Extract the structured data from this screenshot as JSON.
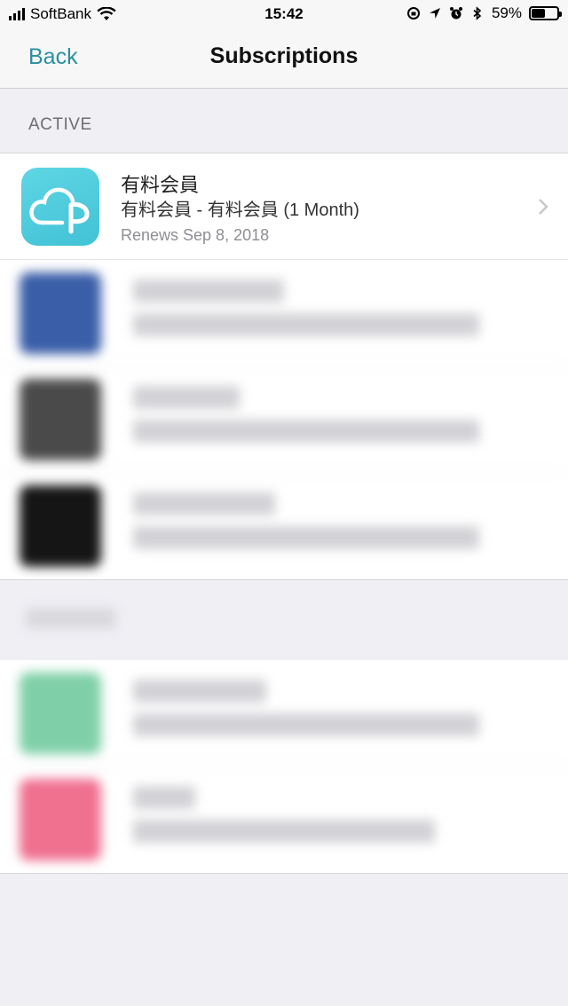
{
  "status": {
    "carrier": "SoftBank",
    "time": "15:42",
    "battery_pct": "59%",
    "battery_level": 0.59
  },
  "nav": {
    "back_label": "Back",
    "title": "Subscriptions"
  },
  "section": {
    "active_label": "ACTIVE"
  },
  "subscriptions": [
    {
      "name": "有料会員",
      "detail": "有料会員 - 有料会員 (1 Month)",
      "renews": "Renews Sep 8, 2018",
      "icon": "pairs-cloud-icon",
      "icon_color": "#4ecbdc"
    }
  ],
  "colors": {
    "accent": "#2a8fa0",
    "background": "#efeff4"
  }
}
